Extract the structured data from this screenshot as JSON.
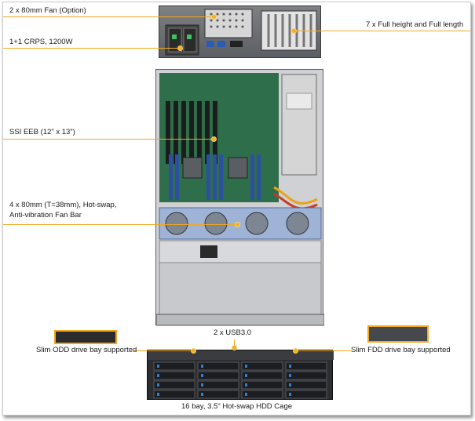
{
  "labels": {
    "fan_option": "2 x 80mm Fan (Option)",
    "slots": "7 x Full height and Full length",
    "psu": "1+1 CRPS, 1200W",
    "board": "SSI EEB (12\" x 13\")",
    "fans_line1": "4 x 80mm (T=38mm), Hot-swap,",
    "fans_line2": "Anti-vibration Fan Bar",
    "usb": "2 x USB3.0",
    "odd": "Slim ODD drive bay supported",
    "fdd": "Slim FDD drive bay supported",
    "hdd": "16 bay, 3.5\" Hot-swap HDD Cage"
  },
  "colors": {
    "accent": "#f2a81d",
    "chassis": "#cfd1d4",
    "motherboard": "#2e6e4a",
    "fan": "#9fb3d6",
    "dimm": "#2c4fa3"
  }
}
